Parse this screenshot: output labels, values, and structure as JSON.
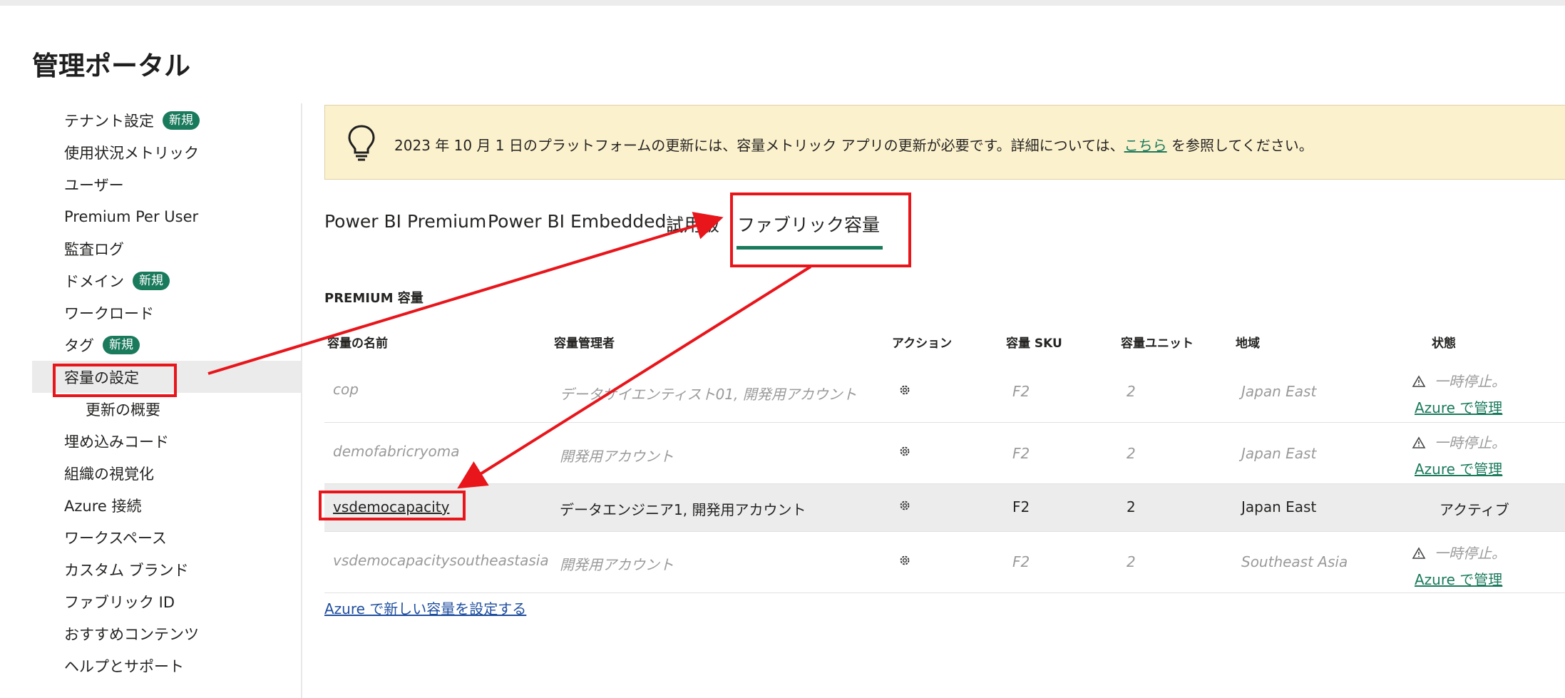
{
  "page": {
    "title": "管理ポータル"
  },
  "sidebar": {
    "items": [
      {
        "label": "テナント設定",
        "badge": "新規"
      },
      {
        "label": "使用状況メトリック"
      },
      {
        "label": "ユーザー"
      },
      {
        "label": "Premium Per User"
      },
      {
        "label": "監査ログ"
      },
      {
        "label": "ドメイン",
        "badge": "新規"
      },
      {
        "label": "ワークロード"
      },
      {
        "label": "タグ",
        "badge": "新規"
      },
      {
        "label": "容量の設定",
        "selected": true
      },
      {
        "label": "更新の概要",
        "sub": true
      },
      {
        "label": "埋め込みコード"
      },
      {
        "label": "組織の視覚化"
      },
      {
        "label": "Azure 接続"
      },
      {
        "label": "ワークスペース"
      },
      {
        "label": "カスタム ブランド"
      },
      {
        "label": "ファブリック ID"
      },
      {
        "label": "おすすめコンテンツ"
      },
      {
        "label": "ヘルプとサポート"
      }
    ]
  },
  "banner": {
    "text_before": "2023 年 10 月 1 日のプラットフォームの更新には、容量メトリック アプリの更新が必要です。詳細については、",
    "link": "こちら",
    "text_after": " を参照してください。",
    "icon": "lightbulb-icon"
  },
  "tabs": [
    {
      "label": "Power BI Premium"
    },
    {
      "label": "Power BI Embedded"
    },
    {
      "label": "試用版"
    },
    {
      "label": "ファブリック容量",
      "active": true
    }
  ],
  "section": {
    "title": "PREMIUM 容量"
  },
  "table": {
    "headers": [
      "容量の名前",
      "容量管理者",
      "アクション",
      "容量 SKU",
      "容量ユニット",
      "地域",
      "状態"
    ],
    "rows": [
      {
        "name": "cop",
        "admins": "データサイエンティスト01, 開発用アカウント",
        "sku": "F2",
        "units": "2",
        "region": "Japan East",
        "status": "一時停止。",
        "manage": "Azure で管理",
        "state": "paused"
      },
      {
        "name": "demofabricryoma",
        "admins": "開発用アカウント",
        "sku": "F2",
        "units": "2",
        "region": "Japan East",
        "status": "一時停止。",
        "manage": "Azure で管理",
        "state": "paused"
      },
      {
        "name": "vsdemocapacity",
        "admins": "データエンジニア1, 開発用アカウント",
        "sku": "F2",
        "units": "2",
        "region": "Japan East",
        "status": "アクティブ",
        "state": "active"
      },
      {
        "name": "vsdemocapacitysoutheastasia",
        "admins": "開発用アカウント",
        "sku": "F2",
        "units": "2",
        "region": "Southeast Asia",
        "status": "一時停止。",
        "manage": "Azure で管理",
        "state": "paused"
      }
    ]
  },
  "add_capacity_link": "Azure で新しい容量を設定する",
  "colors": {
    "accent": "#1a7a5c",
    "banner_bg": "#fcf1cd",
    "annotation": "#e8151b"
  }
}
